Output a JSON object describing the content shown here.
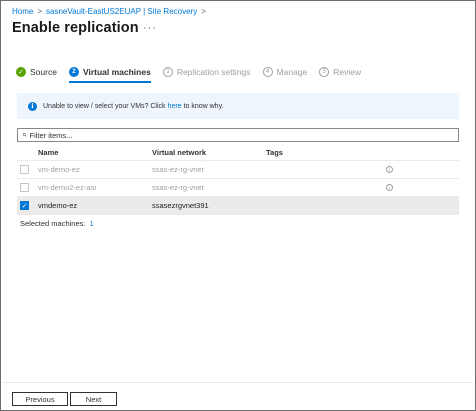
{
  "breadcrumb": [
    {
      "label": "Home"
    },
    {
      "label": "sasneVault-EastUS2EUAP | Site Recovery"
    }
  ],
  "breadcrumb_separator": ">",
  "page": {
    "title": "Enable replication",
    "more_label": "···"
  },
  "steps": [
    {
      "label": "Source",
      "marker": "✓",
      "state": "complete"
    },
    {
      "label": "Virtual machines",
      "marker": "2",
      "state": "active"
    },
    {
      "label": "Replication settings",
      "marker": "3",
      "state": "pending"
    },
    {
      "label": "Manage",
      "marker": "4",
      "state": "pending"
    },
    {
      "label": "Review",
      "marker": "5",
      "state": "pending"
    }
  ],
  "info_banner": {
    "icon": "info-icon",
    "prefix": "Unable to view / select your VMs? Click",
    "link": "here",
    "suffix": "to know why."
  },
  "filter": {
    "placeholder": "Filter items...",
    "value": ""
  },
  "table": {
    "columns": {
      "name": "Name",
      "network": "Virtual network",
      "tags": "Tags"
    },
    "rows": [
      {
        "name": "vm-demo-ez",
        "network": "ssas-ez-rg-vnet",
        "tags": "",
        "checked": false,
        "disabled": true,
        "info": true
      },
      {
        "name": "vm-demo2-ez-asr",
        "network": "ssas-ez-rg-vnet",
        "tags": "",
        "checked": false,
        "disabled": true,
        "info": true
      },
      {
        "name": "vmdemo-ez",
        "network": "ssasezrgvnet391",
        "tags": "",
        "checked": true,
        "disabled": false,
        "info": false
      }
    ]
  },
  "selected_machines": {
    "label": "Selected machines:",
    "count": "1"
  },
  "footer": {
    "previous_label": "Previous",
    "next_label": "Next"
  },
  "colors": {
    "accent": "#0078d4",
    "success": "#57a300",
    "info_background": "#eef5fc",
    "disabled_text": "#a19f9d"
  }
}
